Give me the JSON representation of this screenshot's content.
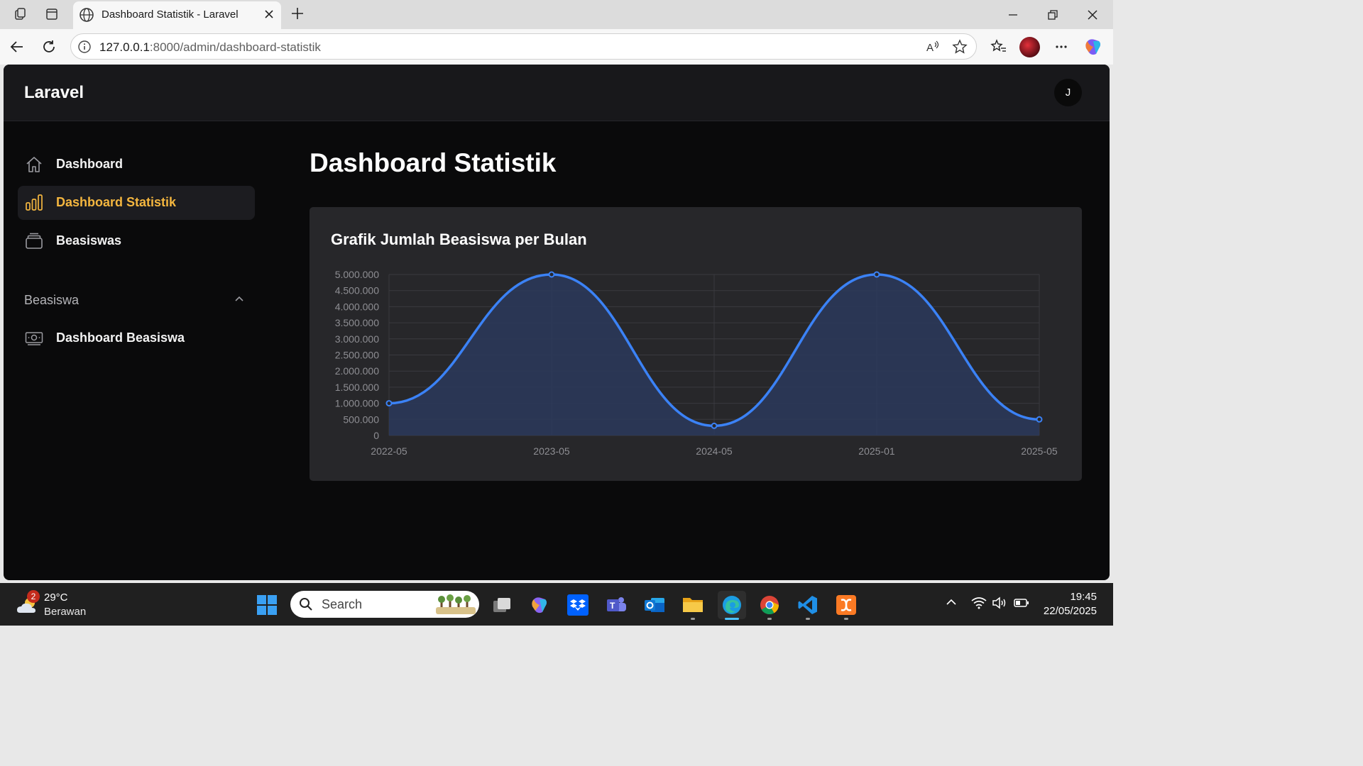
{
  "browser": {
    "tab_title": "Dashboard Statistik - Laravel",
    "url_host": "127.0.0.1",
    "url_rest": ":8000/admin/dashboard-statistik"
  },
  "app": {
    "brand": "Laravel",
    "user_initial": "J"
  },
  "sidebar": {
    "items": [
      {
        "label": "Dashboard",
        "icon": "home-icon"
      },
      {
        "label": "Dashboard Statistik",
        "icon": "bar-chart-icon",
        "active": true
      },
      {
        "label": "Beasiswas",
        "icon": "stack-icon"
      }
    ],
    "group": {
      "label": "Beasiswa",
      "items": [
        {
          "label": "Dashboard Beasiswa",
          "icon": "banknote-icon"
        }
      ]
    }
  },
  "main": {
    "page_title": "Dashboard Statistik",
    "card_title": "Grafik Jumlah Beasiswa per Bulan"
  },
  "chart_data": {
    "type": "area",
    "title": "Grafik Jumlah Beasiswa per Bulan",
    "categories": [
      "2022-05",
      "2023-05",
      "2024-05",
      "2025-01",
      "2025-05"
    ],
    "series": [
      {
        "values": [
          1000000,
          5000000,
          300000,
          5000000,
          500000
        ]
      }
    ],
    "ylim": [
      0,
      5000000
    ],
    "yticks": [
      "0",
      "500.000",
      "1.000.000",
      "1.500.000",
      "2.000.000",
      "2.500.000",
      "3.000.000",
      "3.500.000",
      "4.000.000",
      "4.500.000",
      "5.000.000"
    ],
    "grid": true,
    "legend": "none",
    "colors": {
      "line": "#3b82f6",
      "fill": "#2c3a5c"
    }
  },
  "taskbar": {
    "weather_temp": "29°C",
    "weather_cond": "Berawan",
    "weather_badge": "2",
    "search_placeholder": "Search",
    "time": "19:45",
    "date": "22/05/2025"
  }
}
